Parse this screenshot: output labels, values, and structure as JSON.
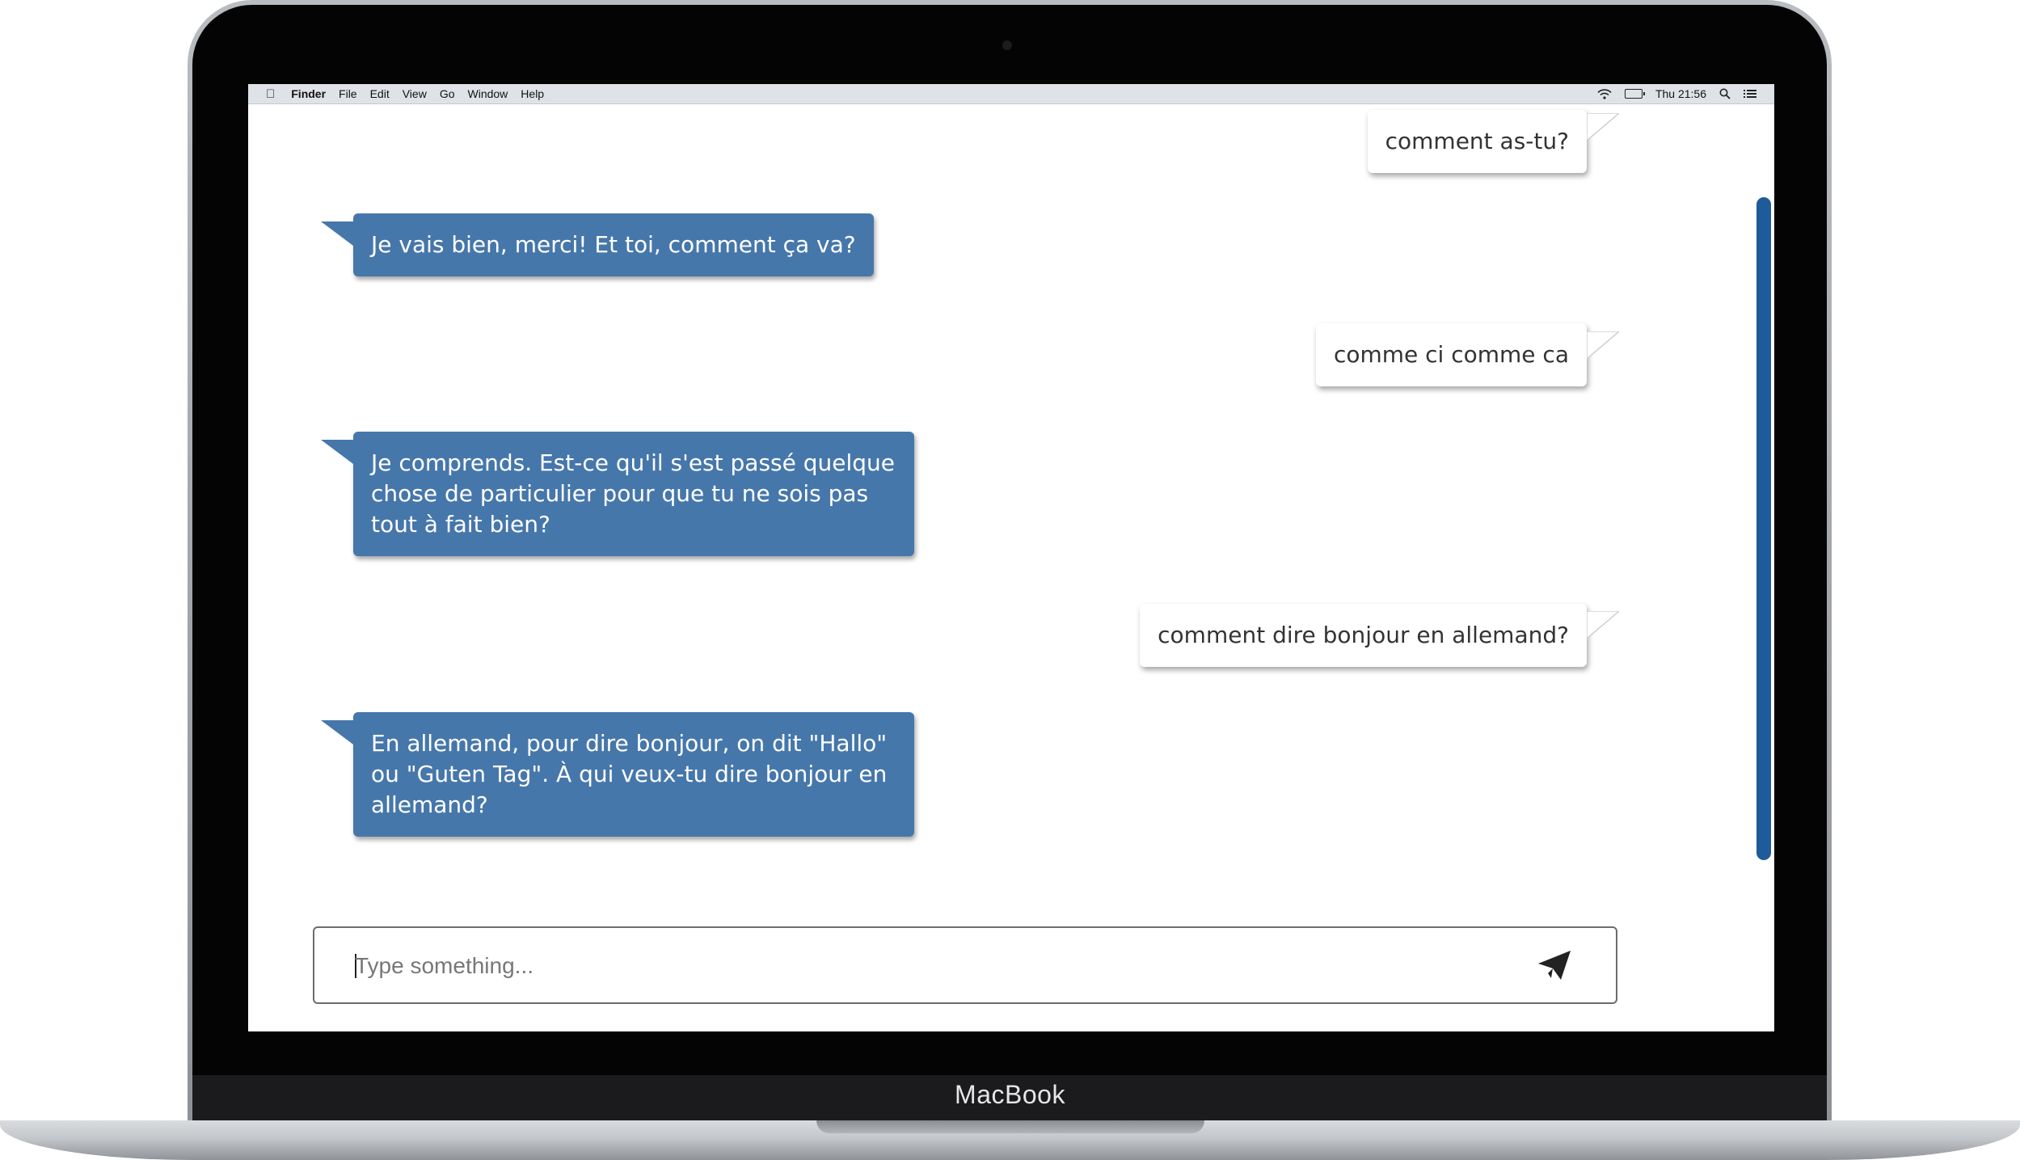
{
  "device": {
    "brand": "MacBook"
  },
  "menubar": {
    "apple_icon": "apple-logo-icon",
    "items": [
      "Finder",
      "File",
      "Edit",
      "View",
      "Go",
      "Window",
      "Help"
    ],
    "clock": "Thu 21:56",
    "status_icons": [
      "wifi-icon",
      "battery-charging-icon",
      "spotlight-search-icon",
      "notification-list-icon"
    ]
  },
  "chat": {
    "colors": {
      "bot_bubble": "#4677ab",
      "user_bubble": "#ffffff",
      "scrollbar": "#1f5a9a"
    },
    "messages": [
      {
        "sender": "user",
        "text": "comment as-tu?"
      },
      {
        "sender": "bot",
        "text": "Je vais bien, merci! Et toi, comment ça va?"
      },
      {
        "sender": "user",
        "text": "comme ci comme ca"
      },
      {
        "sender": "bot",
        "text": "Je comprends. Est-ce qu'il s'est passé quelque chose de particulier pour que tu ne sois pas tout à fait bien?"
      },
      {
        "sender": "user",
        "text": "comment dire bonjour en allemand?"
      },
      {
        "sender": "bot",
        "text": "En allemand, pour dire bonjour, on dit \"Hallo\" ou \"Guten Tag\". À qui veux-tu dire bonjour en allemand?"
      }
    ]
  },
  "composer": {
    "placeholder": "Type something...",
    "value": "",
    "send_icon": "paper-plane-icon"
  }
}
